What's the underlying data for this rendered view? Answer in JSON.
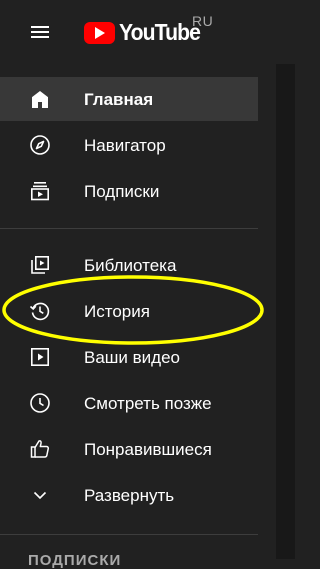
{
  "header": {
    "menu_icon": "hamburger-menu-icon",
    "logo_text": "YouTube",
    "region": "RU",
    "logo_icon": "youtube-play-icon"
  },
  "sidebar": {
    "primary": [
      {
        "label": "Главная",
        "icon": "home-icon",
        "active": true
      },
      {
        "label": "Навигатор",
        "icon": "compass-icon",
        "active": false
      },
      {
        "label": "Подписки",
        "icon": "subscriptions-icon",
        "active": false
      }
    ],
    "library": [
      {
        "label": "Библиотека",
        "icon": "library-icon"
      },
      {
        "label": "История",
        "icon": "history-icon"
      },
      {
        "label": "Ваши видео",
        "icon": "your-videos-icon"
      },
      {
        "label": "Смотреть позже",
        "icon": "watch-later-icon"
      },
      {
        "label": "Понравившиеся",
        "icon": "thumbs-up-icon"
      },
      {
        "label": "Развернуть",
        "icon": "chevron-down-icon"
      }
    ],
    "next_section_title": "ПОДПИСКИ"
  },
  "colors": {
    "background": "#212121",
    "active_item": "#383838",
    "logo_red": "#ff0000",
    "highlight": "#ffff00",
    "text": "#ffffff",
    "muted_text": "#aaaaaa"
  }
}
